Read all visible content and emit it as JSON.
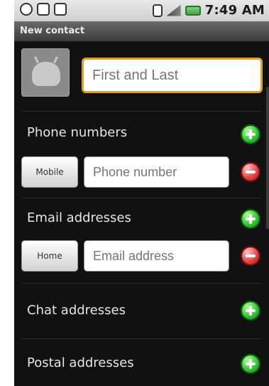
{
  "status_bar": {
    "time": "7:49 AM",
    "colors": {
      "background": "#d7d7d7",
      "battery": "#3fbf3f"
    }
  },
  "title_bar": {
    "title": "New contact"
  },
  "contact_form": {
    "name_placeholder": "First and Last",
    "sections": {
      "phone": {
        "label": "Phone numbers",
        "type": "Mobile",
        "placeholder": "Phone number"
      },
      "email": {
        "label": "Email addresses",
        "type": "Home",
        "placeholder": "Email address"
      },
      "chat": {
        "label": "Chat addresses"
      },
      "postal": {
        "label": "Postal addresses"
      }
    },
    "colors": {
      "accent_focus": "#e6a21b",
      "add": "#2fbf2f",
      "remove": "#e03b3b"
    }
  }
}
